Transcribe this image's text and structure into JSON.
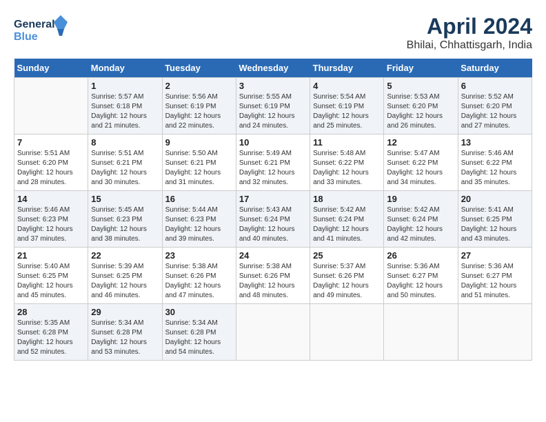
{
  "header": {
    "logo_line1": "General",
    "logo_line2": "Blue",
    "title": "April 2024",
    "subtitle": "Bhilai, Chhattisgarh, India"
  },
  "days_of_week": [
    "Sunday",
    "Monday",
    "Tuesday",
    "Wednesday",
    "Thursday",
    "Friday",
    "Saturday"
  ],
  "weeks": [
    [
      {
        "day": "",
        "info": ""
      },
      {
        "day": "1",
        "info": "Sunrise: 5:57 AM\nSunset: 6:18 PM\nDaylight: 12 hours\nand 21 minutes."
      },
      {
        "day": "2",
        "info": "Sunrise: 5:56 AM\nSunset: 6:19 PM\nDaylight: 12 hours\nand 22 minutes."
      },
      {
        "day": "3",
        "info": "Sunrise: 5:55 AM\nSunset: 6:19 PM\nDaylight: 12 hours\nand 24 minutes."
      },
      {
        "day": "4",
        "info": "Sunrise: 5:54 AM\nSunset: 6:19 PM\nDaylight: 12 hours\nand 25 minutes."
      },
      {
        "day": "5",
        "info": "Sunrise: 5:53 AM\nSunset: 6:20 PM\nDaylight: 12 hours\nand 26 minutes."
      },
      {
        "day": "6",
        "info": "Sunrise: 5:52 AM\nSunset: 6:20 PM\nDaylight: 12 hours\nand 27 minutes."
      }
    ],
    [
      {
        "day": "7",
        "info": "Sunrise: 5:51 AM\nSunset: 6:20 PM\nDaylight: 12 hours\nand 28 minutes."
      },
      {
        "day": "8",
        "info": "Sunrise: 5:51 AM\nSunset: 6:21 PM\nDaylight: 12 hours\nand 30 minutes."
      },
      {
        "day": "9",
        "info": "Sunrise: 5:50 AM\nSunset: 6:21 PM\nDaylight: 12 hours\nand 31 minutes."
      },
      {
        "day": "10",
        "info": "Sunrise: 5:49 AM\nSunset: 6:21 PM\nDaylight: 12 hours\nand 32 minutes."
      },
      {
        "day": "11",
        "info": "Sunrise: 5:48 AM\nSunset: 6:22 PM\nDaylight: 12 hours\nand 33 minutes."
      },
      {
        "day": "12",
        "info": "Sunrise: 5:47 AM\nSunset: 6:22 PM\nDaylight: 12 hours\nand 34 minutes."
      },
      {
        "day": "13",
        "info": "Sunrise: 5:46 AM\nSunset: 6:22 PM\nDaylight: 12 hours\nand 35 minutes."
      }
    ],
    [
      {
        "day": "14",
        "info": "Sunrise: 5:46 AM\nSunset: 6:23 PM\nDaylight: 12 hours\nand 37 minutes."
      },
      {
        "day": "15",
        "info": "Sunrise: 5:45 AM\nSunset: 6:23 PM\nDaylight: 12 hours\nand 38 minutes."
      },
      {
        "day": "16",
        "info": "Sunrise: 5:44 AM\nSunset: 6:23 PM\nDaylight: 12 hours\nand 39 minutes."
      },
      {
        "day": "17",
        "info": "Sunrise: 5:43 AM\nSunset: 6:24 PM\nDaylight: 12 hours\nand 40 minutes."
      },
      {
        "day": "18",
        "info": "Sunrise: 5:42 AM\nSunset: 6:24 PM\nDaylight: 12 hours\nand 41 minutes."
      },
      {
        "day": "19",
        "info": "Sunrise: 5:42 AM\nSunset: 6:24 PM\nDaylight: 12 hours\nand 42 minutes."
      },
      {
        "day": "20",
        "info": "Sunrise: 5:41 AM\nSunset: 6:25 PM\nDaylight: 12 hours\nand 43 minutes."
      }
    ],
    [
      {
        "day": "21",
        "info": "Sunrise: 5:40 AM\nSunset: 6:25 PM\nDaylight: 12 hours\nand 45 minutes."
      },
      {
        "day": "22",
        "info": "Sunrise: 5:39 AM\nSunset: 6:25 PM\nDaylight: 12 hours\nand 46 minutes."
      },
      {
        "day": "23",
        "info": "Sunrise: 5:38 AM\nSunset: 6:26 PM\nDaylight: 12 hours\nand 47 minutes."
      },
      {
        "day": "24",
        "info": "Sunrise: 5:38 AM\nSunset: 6:26 PM\nDaylight: 12 hours\nand 48 minutes."
      },
      {
        "day": "25",
        "info": "Sunrise: 5:37 AM\nSunset: 6:26 PM\nDaylight: 12 hours\nand 49 minutes."
      },
      {
        "day": "26",
        "info": "Sunrise: 5:36 AM\nSunset: 6:27 PM\nDaylight: 12 hours\nand 50 minutes."
      },
      {
        "day": "27",
        "info": "Sunrise: 5:36 AM\nSunset: 6:27 PM\nDaylight: 12 hours\nand 51 minutes."
      }
    ],
    [
      {
        "day": "28",
        "info": "Sunrise: 5:35 AM\nSunset: 6:28 PM\nDaylight: 12 hours\nand 52 minutes."
      },
      {
        "day": "29",
        "info": "Sunrise: 5:34 AM\nSunset: 6:28 PM\nDaylight: 12 hours\nand 53 minutes."
      },
      {
        "day": "30",
        "info": "Sunrise: 5:34 AM\nSunset: 6:28 PM\nDaylight: 12 hours\nand 54 minutes."
      },
      {
        "day": "",
        "info": ""
      },
      {
        "day": "",
        "info": ""
      },
      {
        "day": "",
        "info": ""
      },
      {
        "day": "",
        "info": ""
      }
    ]
  ]
}
